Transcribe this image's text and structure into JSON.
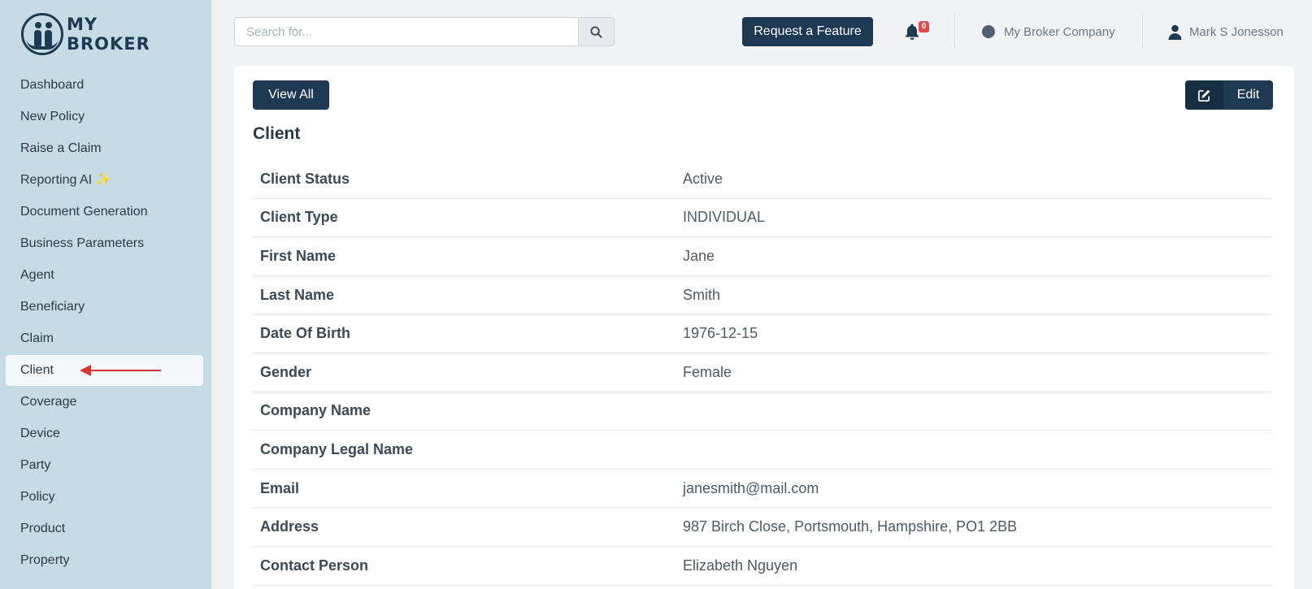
{
  "brand": {
    "line1": "MY",
    "line2": "BROKER"
  },
  "sidebar": {
    "items": [
      {
        "label": "Dashboard"
      },
      {
        "label": "New Policy"
      },
      {
        "label": "Raise a Claim"
      },
      {
        "label": "Reporting AI",
        "suffix": "✨"
      },
      {
        "label": "Document Generation"
      },
      {
        "label": "Business Parameters"
      },
      {
        "label": "Agent"
      },
      {
        "label": "Beneficiary"
      },
      {
        "label": "Claim"
      },
      {
        "label": "Client"
      },
      {
        "label": "Coverage"
      },
      {
        "label": "Device"
      },
      {
        "label": "Party"
      },
      {
        "label": "Policy"
      },
      {
        "label": "Product"
      },
      {
        "label": "Property"
      }
    ],
    "active_index": 9
  },
  "header": {
    "search_placeholder": "Search for...",
    "request_feature_label": "Request a Feature",
    "notification_count": "0",
    "company": "My Broker Company",
    "user": "Mark S Jonesson"
  },
  "main": {
    "view_all_label": "View All",
    "edit_label": "Edit",
    "title": "Client",
    "fields": [
      {
        "label": "Client Status",
        "value": "Active"
      },
      {
        "label": "Client Type",
        "value": "INDIVIDUAL"
      },
      {
        "label": "First Name",
        "value": "Jane"
      },
      {
        "label": "Last Name",
        "value": "Smith"
      },
      {
        "label": "Date Of Birth",
        "value": "1976-12-15"
      },
      {
        "label": "Gender",
        "value": "Female"
      },
      {
        "label": "Company Name",
        "value": ""
      },
      {
        "label": "Company Legal Name",
        "value": ""
      },
      {
        "label": "Email",
        "value": "janesmith@mail.com"
      },
      {
        "label": "Address",
        "value": "987 Birch Close, Portsmouth, Hampshire, PO1 2BB"
      },
      {
        "label": "Contact Person",
        "value": "Elizabeth Nguyen"
      }
    ]
  },
  "colors": {
    "sidebar_bg": "#c5dbe5",
    "primary": "#1d3a52",
    "badge": "#e04a4a",
    "annotation_arrow": "#d93636"
  }
}
